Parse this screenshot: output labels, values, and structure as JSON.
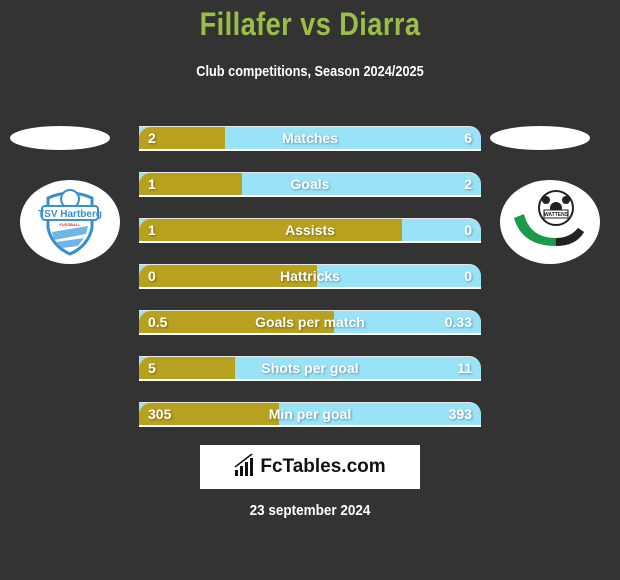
{
  "header": {
    "title": "Fillafer vs Diarra",
    "subtitle": "Club competitions, Season 2024/2025"
  },
  "teams": {
    "left": {
      "name": "TSV Hartberg",
      "logo_icon": "tsv-hartberg-crest-icon"
    },
    "right": {
      "name": "WSG Swarovski Wattens",
      "logo_icon": "wsg-swarovski-crest-icon"
    }
  },
  "colors": {
    "left_bar": "#b8a11d",
    "right_bar": "#99e3f9",
    "title": "#9bbf46",
    "background": "#333333"
  },
  "stats": [
    {
      "label": "Matches",
      "left": "2",
      "right": "6",
      "left_share": 0.25
    },
    {
      "label": "Goals",
      "left": "1",
      "right": "2",
      "left_share": 0.3
    },
    {
      "label": "Assists",
      "left": "1",
      "right": "0",
      "left_share": 0.77
    },
    {
      "label": "Hattricks",
      "left": "0",
      "right": "0",
      "left_share": 0.52
    },
    {
      "label": "Goals per match",
      "left": "0.5",
      "right": "0.33",
      "left_share": 0.57
    },
    {
      "label": "Shots per goal",
      "left": "5",
      "right": "11",
      "left_share": 0.28
    },
    {
      "label": "Min per goal",
      "left": "305",
      "right": "393",
      "left_share": 0.41
    }
  ],
  "brand": {
    "name": "FcTables.com",
    "icon": "bar-chart-icon"
  },
  "date": "23 september 2024"
}
